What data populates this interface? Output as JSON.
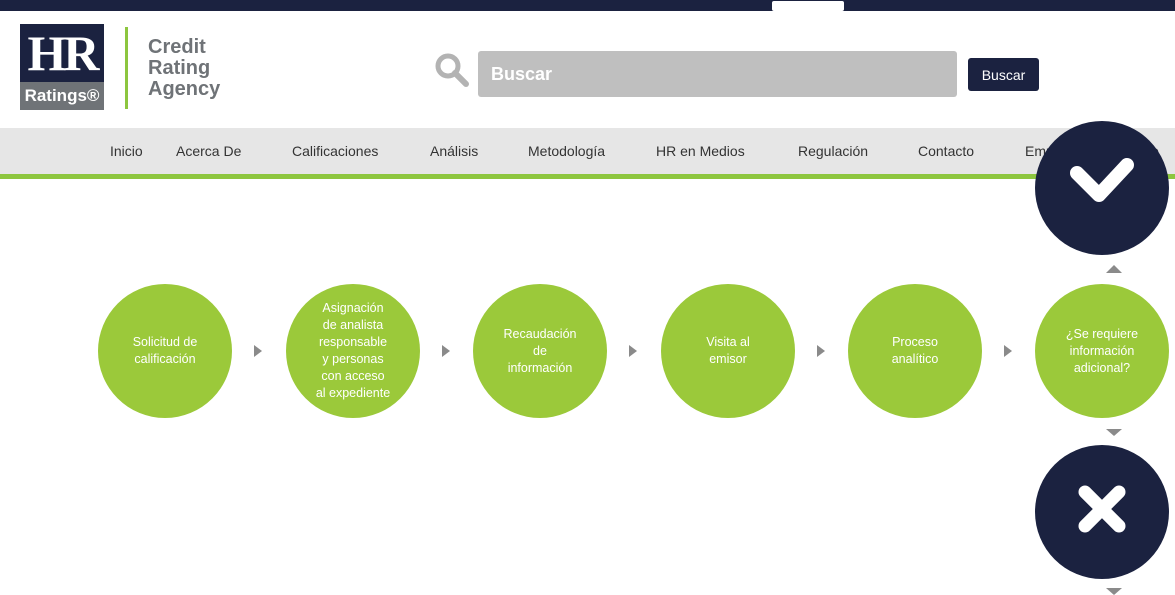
{
  "header": {
    "logo": {
      "hr": "HR",
      "ratings": "Ratings®"
    },
    "agency_lines": [
      "Credit",
      "Rating",
      "Agency"
    ],
    "search": {
      "placeholder": "Buscar",
      "button_label": "Buscar",
      "icon": "search-icon"
    }
  },
  "nav": {
    "items": [
      "Inicio",
      "Acerca De",
      "Calificaciones",
      "Análisis",
      "Metodología",
      "HR en Medios",
      "Regulación",
      "Contacto",
      "Empresa Sustentable"
    ]
  },
  "process": {
    "steps": [
      {
        "lines": [
          "Solicitud de",
          "calificación"
        ]
      },
      {
        "lines": [
          "Asignación",
          "de analista",
          "responsable",
          "y personas",
          "con acceso",
          "al expediente"
        ]
      },
      {
        "lines": [
          "Recaudación",
          "de",
          "información"
        ]
      },
      {
        "lines": [
          "Visita al",
          "emisor"
        ]
      },
      {
        "lines": [
          "Proceso",
          "analítico"
        ]
      },
      {
        "lines": [
          "¿Se requiere",
          "información",
          "adicional?"
        ]
      }
    ],
    "yes_icon": "check-icon",
    "no_icon": "close-icon"
  },
  "colors": {
    "navy": "#1b2240",
    "green": "#9bc93a",
    "accent_green": "#8dc63f",
    "gray": "#6f7377",
    "nav_bg": "#e6e6e6"
  }
}
